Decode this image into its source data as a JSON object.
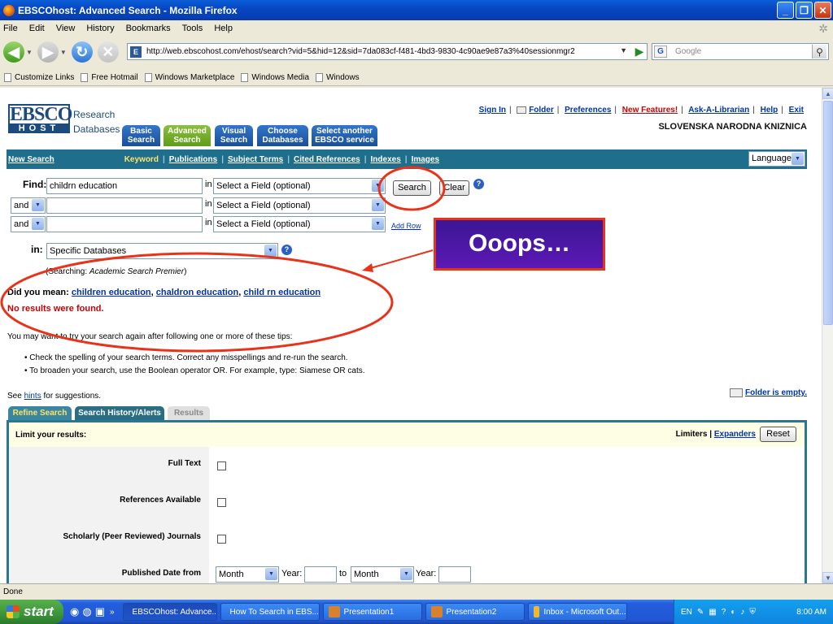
{
  "window": {
    "title": "EBSCOhost: Advanced Search - Mozilla Firefox"
  },
  "menu": [
    "File",
    "Edit",
    "View",
    "History",
    "Bookmarks",
    "Tools",
    "Help"
  ],
  "address": {
    "url": "http://web.ebscohost.com/ehost/search?vid=5&hid=12&sid=7da083cf-f481-4bd3-9830-4c90ae9e87a3%40sessionmgr2",
    "search_placeholder": "Google"
  },
  "bookmarks": [
    "Customize Links",
    "Free Hotmail",
    "Windows Marketplace",
    "Windows Media",
    "Windows"
  ],
  "ebsco": {
    "logo_top": "EBSCO",
    "logo_bottom": "HOST",
    "brand_line1": "Research",
    "brand_line2": "Databases",
    "tabs": [
      {
        "l1": "Basic",
        "l2": "Search"
      },
      {
        "l1": "Advanced",
        "l2": "Search"
      },
      {
        "l1": "Visual",
        "l2": "Search"
      },
      {
        "l1": "Choose",
        "l2": "Databases"
      },
      {
        "l1": "Select another",
        "l2": "EBSCO service"
      }
    ],
    "top_links": [
      "Sign In",
      "Folder",
      "Preferences",
      "New Features!",
      "Ask-A-Librarian",
      "Help",
      "Exit"
    ],
    "library": "SLOVENSKA NARODNA KNIZNICA",
    "nav": {
      "new_search": "New Search",
      "keyword": "Keyword",
      "links": [
        "Publications",
        "Subject Terms",
        "Cited References",
        "Indexes",
        "Images"
      ]
    },
    "language": "Language"
  },
  "form": {
    "find_label": "Find:",
    "row1_value": "childrn education",
    "row2_op": "and",
    "row3_op": "and",
    "in_label": "in",
    "field_placeholder": "Select a Field (optional)",
    "search_button": "Search",
    "clear_button": "Clear",
    "add_row": "Add Row",
    "in_db_label": "in:",
    "db_value": "Specific Databases",
    "searching_prefix": "(Searching: ",
    "searching_db": "Academic Search Premier",
    "searching_suffix": ")"
  },
  "results": {
    "did_you_mean": "Did you mean:",
    "suggestions": [
      "children education",
      "chaldron education",
      "child rn education"
    ],
    "no_results": "No results were found.",
    "tips_intro": "You may want to try your search again after following one or more of these tips:",
    "tips": [
      "Check the spelling of your search terms. Correct any misspellings and re-run the search.",
      "To broaden your search, use the Boolean operator OR. For example, type: Siamese OR cats."
    ],
    "hints_prefix": "See ",
    "hints_link": "hints",
    "hints_suffix": " for suggestions.",
    "folder_empty": "Folder is empty."
  },
  "annotation": {
    "callout": "Ooops…"
  },
  "refine": {
    "tabs": [
      "Refine Search",
      "Search History/Alerts",
      "Results"
    ],
    "limit_title": "Limit your results:",
    "limiters": "Limiters",
    "expanders": "Expanders",
    "reset": "Reset",
    "rows": [
      "Full Text",
      "References Available",
      "Scholarly (Peer Reviewed) Journals",
      "Published Date from"
    ],
    "month": "Month",
    "year": "Year:",
    "to": "to"
  },
  "status": "Done",
  "taskbar": {
    "start": "start",
    "tasks": [
      "EBSCOhost: Advance...",
      "How To Search in EBS...",
      "Presentation1",
      "Presentation2",
      "Inbox - Microsoft Out..."
    ],
    "lang": "EN",
    "clock": "8:00 AM"
  },
  "colors": {
    "ebsco_blue": "#1c4c7d",
    "nav_bar": "#1f6e8c",
    "annotation_red": "#e8331b",
    "callout_bg": "#4b17a5",
    "error_red": "#cc0000"
  }
}
